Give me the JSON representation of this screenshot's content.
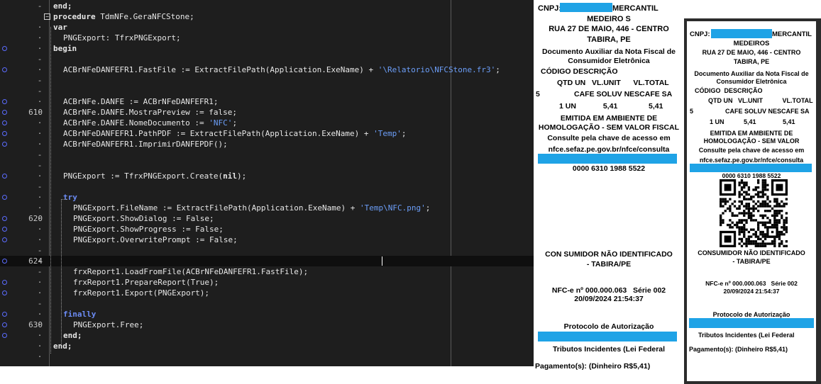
{
  "editor": {
    "lines": [
      {
        "ln": "",
        "gm": "-",
        "fold": "",
        "bp": false,
        "ind": 0,
        "parts": [
          [
            "kw",
            "end;"
          ]
        ]
      },
      {
        "ln": "",
        "gm": "·",
        "fold": "⊟",
        "bp": false,
        "ind": 0,
        "parts": [
          [
            "kw",
            "procedure "
          ],
          [
            "id",
            "TdmNFe.GeraNFCStone;"
          ]
        ]
      },
      {
        "ln": "",
        "gm": "·",
        "fold": "",
        "bp": false,
        "ind": 0,
        "parts": [
          [
            "kw",
            "var"
          ]
        ]
      },
      {
        "ln": "",
        "gm": "·",
        "fold": "",
        "bp": false,
        "ind": 1,
        "parts": [
          [
            "id",
            "PNGExport: TfrxPNGExport;"
          ]
        ]
      },
      {
        "ln": "",
        "gm": "·",
        "fold": "",
        "bp": true,
        "ind": 0,
        "parts": [
          [
            "kw",
            "begin"
          ]
        ]
      },
      {
        "ln": "",
        "gm": "-",
        "fold": "",
        "bp": false,
        "ind": 0,
        "parts": []
      },
      {
        "ln": "",
        "gm": "·",
        "fold": "",
        "bp": true,
        "ind": 1,
        "parts": [
          [
            "id",
            "ACBrNFeDANFEFR1.FastFile := ExtractFilePath(Application.ExeName) + "
          ],
          [
            "str",
            "'\\Relatorio\\NFCStone.fr3'"
          ],
          [
            "id",
            ";"
          ]
        ]
      },
      {
        "ln": "",
        "gm": "-",
        "fold": "",
        "bp": false,
        "ind": 0,
        "parts": []
      },
      {
        "ln": "",
        "gm": "-",
        "fold": "",
        "bp": false,
        "ind": 0,
        "parts": []
      },
      {
        "ln": "",
        "gm": "·",
        "fold": "",
        "bp": true,
        "ind": 1,
        "parts": [
          [
            "id",
            "ACBrNFe.DANFE := ACBrNFeDANFEFR1;"
          ]
        ]
      },
      {
        "ln": "610",
        "gm": "·",
        "fold": "",
        "bp": true,
        "ind": 1,
        "parts": [
          [
            "id",
            "ACBrNFe.DANFE.MostraPreview := false;"
          ]
        ]
      },
      {
        "ln": "",
        "gm": "·",
        "fold": "",
        "bp": true,
        "ind": 1,
        "parts": [
          [
            "id",
            "ACBrNFe.DANFE.NomeDocumento := "
          ],
          [
            "str",
            "'NFC'"
          ],
          [
            "id",
            ";"
          ]
        ]
      },
      {
        "ln": "",
        "gm": "·",
        "fold": "",
        "bp": true,
        "ind": 1,
        "parts": [
          [
            "id",
            "ACBrNFeDANFEFR1.PathPDF := ExtractFilePath(Application.ExeName) + "
          ],
          [
            "str",
            "'Temp'"
          ],
          [
            "id",
            ";"
          ]
        ]
      },
      {
        "ln": "",
        "gm": "·",
        "fold": "",
        "bp": true,
        "ind": 1,
        "parts": [
          [
            "id",
            "ACBrNFeDANFEFR1.ImprimirDANFEPDF();"
          ]
        ]
      },
      {
        "ln": "",
        "gm": "-",
        "fold": "",
        "bp": false,
        "ind": 0,
        "parts": []
      },
      {
        "ln": "",
        "gm": "-",
        "fold": "",
        "bp": false,
        "ind": 0,
        "parts": []
      },
      {
        "ln": "",
        "gm": "·",
        "fold": "",
        "bp": true,
        "ind": 1,
        "parts": [
          [
            "id",
            "PNGExport := TfrxPNGExport.Create("
          ],
          [
            "kw",
            "nil"
          ],
          [
            "id",
            ");"
          ]
        ]
      },
      {
        "ln": "",
        "gm": "-",
        "fold": "",
        "bp": false,
        "ind": 0,
        "parts": []
      },
      {
        "ln": "",
        "gm": "·",
        "fold": "",
        "bp": true,
        "ind": 1,
        "parts": [
          [
            "kwb",
            "try"
          ]
        ]
      },
      {
        "ln": "",
        "gm": "·",
        "fold": "",
        "bp": false,
        "ind": 2,
        "parts": [
          [
            "id",
            "PNGExport.FileName := ExtractFilePath(Application.ExeName) + "
          ],
          [
            "str",
            "'Temp\\NFC.png'"
          ],
          [
            "id",
            ";"
          ]
        ]
      },
      {
        "ln": "620",
        "gm": "·",
        "fold": "",
        "bp": true,
        "ind": 2,
        "parts": [
          [
            "id",
            "PNGExport.ShowDialog := False;"
          ]
        ]
      },
      {
        "ln": "",
        "gm": "·",
        "fold": "",
        "bp": true,
        "ind": 2,
        "parts": [
          [
            "id",
            "PNGExport.ShowProgress := False;"
          ]
        ]
      },
      {
        "ln": "",
        "gm": "·",
        "fold": "",
        "bp": true,
        "ind": 2,
        "parts": [
          [
            "id",
            "PNGExport.OverwritePrompt := False;"
          ]
        ]
      },
      {
        "ln": "",
        "gm": "-",
        "fold": "",
        "bp": false,
        "ind": 0,
        "parts": []
      },
      {
        "ln": "624",
        "gm": "·",
        "fold": "",
        "bp": true,
        "ind": 0,
        "parts": [],
        "current": true
      },
      {
        "ln": "",
        "gm": "-",
        "fold": "",
        "bp": false,
        "ind": 2,
        "parts": [
          [
            "id",
            "frxReport1.LoadFromFile(ACBrNFeDANFEFR1.FastFile);"
          ]
        ]
      },
      {
        "ln": "",
        "gm": "·",
        "fold": "",
        "bp": true,
        "ind": 2,
        "parts": [
          [
            "id",
            "frxReport1.PrepareReport(True);"
          ]
        ]
      },
      {
        "ln": "",
        "gm": "·",
        "fold": "",
        "bp": true,
        "ind": 2,
        "parts": [
          [
            "id",
            "frxReport1.Export(PNGExport);"
          ]
        ]
      },
      {
        "ln": "",
        "gm": "-",
        "fold": "",
        "bp": false,
        "ind": 0,
        "parts": []
      },
      {
        "ln": "",
        "gm": "·",
        "fold": "",
        "bp": true,
        "ind": 1,
        "parts": [
          [
            "kwb",
            "finally"
          ]
        ]
      },
      {
        "ln": "630",
        "gm": "·",
        "fold": "",
        "bp": true,
        "ind": 2,
        "parts": [
          [
            "id",
            "PNGExport.Free;"
          ]
        ]
      },
      {
        "ln": "",
        "gm": "·",
        "fold": "",
        "bp": true,
        "ind": 1,
        "parts": [
          [
            "kw",
            "end;"
          ]
        ]
      },
      {
        "ln": "",
        "gm": "·",
        "fold": "",
        "bp": false,
        "ind": 0,
        "parts": [
          [
            "kw",
            "end;"
          ]
        ]
      },
      {
        "ln": "",
        "gm": "·",
        "fold": "",
        "bp": false,
        "ind": 0,
        "parts": []
      }
    ]
  },
  "receipt1": {
    "cnpj_label": "CNPJ:",
    "company_suffix": "MERCANTIL",
    "company_line2": "MEDEIRO S",
    "address": "RUA 27 DE MAIO, 446 - CENTRO",
    "city": "TABIRA, PE",
    "doc_title_1": "Documento Auxiliar da Nota Fiscal de",
    "doc_title_2": "Consumidor Eletrônica",
    "col_code_desc": "CÓDIGO DESCRIÇÃO",
    "col_qtd_line": "QTD UN   VL.UNIT      VL.TOTAL",
    "item_code": "5",
    "item_desc": "CAFE SOLUV NESCAFE SA",
    "item_values": "1 UN             5,41               5,41",
    "env_1": "EMITIDA EM AMBIENTE DE",
    "env_2": "HOMOLOGAÇÃO - SEM VALOR FISCAL",
    "consult": "Consulte pela chave de acesso em",
    "url": "nfce.sefaz.pe.gov.br/nfce/consulta",
    "key_part": "0000 6310 1988 5522",
    "consumer_1": "CON SUMIDOR NÃO IDENTIFICADO",
    "consumer_2": "- TABIRA/PE",
    "nfce_line": "NFC-e nº 000.000.063   Série 002",
    "datetime": "20/09/2024 21:54:37",
    "protocol": "Protocolo de Autorização",
    "tributos": "Tributos Incidentes (Lei Federal",
    "payment": "Pagamento(s): (Dinheiro R$5,41)"
  },
  "receipt2": {
    "cnpj_label": "CNPJ:",
    "company_suffix": "MERCANTIL",
    "company_line2": "MEDEIROS",
    "address": "RUA 27 DE MAIO, 446 - CENTRO",
    "city": "TABIRA, PE",
    "doc_title_1": "Documento Auxiliar da Nota Fiscal de",
    "doc_title_2": "Consumidor Eletrônica",
    "col_code_desc": "CÓDIGO  DESCRIÇÃO",
    "col_qtd_line": "QTD UN   VL.UNIT           VL.TOTAL",
    "item_code": "5",
    "item_desc": "CAFE SOLUV NESCAFE SA",
    "item_values": "1 UN           5,41               5,41",
    "env_1": "EMITIDA EM AMBIENTE DE",
    "env_2": "HOMOLOGAÇÃO - SEM VALOR",
    "consult": "Consulte pela chave de acesso em",
    "url": "nfce.sefaz.pe.gov.br/nfce/consulta",
    "key_part": "0000 6310 1988 5522",
    "consumer_1": "CONSUMIDOR NÃO IDENTIFICADO",
    "consumer_2": "- TABIRA/PE",
    "nfce_line": "NFC-e nº 000.000.063   Série 002",
    "datetime": "20/09/2024 21:54:37",
    "protocol": "Protocolo de Autorização",
    "tributos": "Tributos Incidentes (Lei Federal",
    "payment": "Pagamento(s): (Dinheiro R$5,41)"
  },
  "colors": {
    "redaction": "#1fa3e6",
    "editor_bg": "#1e1e1e",
    "string": "#6c9ef8",
    "keyword_blue": "#6c8cf5"
  }
}
